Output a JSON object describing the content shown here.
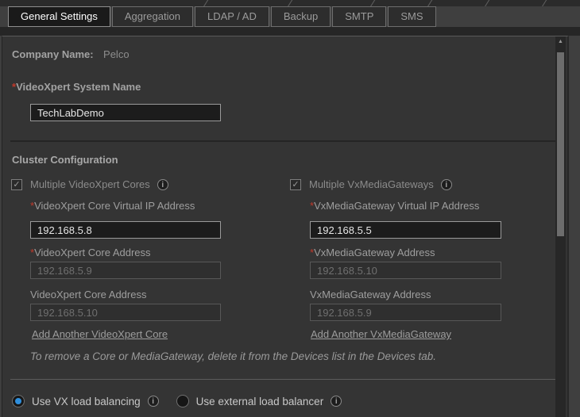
{
  "tabs": [
    {
      "label": "General Settings",
      "active": true
    },
    {
      "label": "Aggregation",
      "active": false
    },
    {
      "label": "LDAP / AD",
      "active": false
    },
    {
      "label": "Backup",
      "active": false
    },
    {
      "label": "SMTP",
      "active": false
    },
    {
      "label": "SMS",
      "active": false
    }
  ],
  "general": {
    "company_label": "Company Name:",
    "company_value": "Pelco",
    "system_name": {
      "required_mark": "*",
      "label": "VideoXpert System Name",
      "value": "TechLabDemo"
    }
  },
  "cluster": {
    "heading": "Cluster Configuration",
    "cores": {
      "checkbox_label": "Multiple VideoXpert Cores",
      "checked": true,
      "fields": [
        {
          "required_mark": "*",
          "label": "VideoXpert Core Virtual IP Address",
          "value": "192.168.5.8",
          "disabled": false
        },
        {
          "required_mark": "*",
          "label": "VideoXpert Core Address",
          "value": "192.168.5.9",
          "disabled": true
        },
        {
          "required_mark": "",
          "label": "VideoXpert Core Address",
          "value": "192.168.5.10",
          "disabled": true
        }
      ],
      "add_link": "Add Another VideoXpert Core"
    },
    "gateways": {
      "checkbox_label": "Multiple VxMediaGateways",
      "checked": true,
      "fields": [
        {
          "required_mark": "*",
          "label": "VxMediaGateway Virtual IP Address",
          "value": "192.168.5.5",
          "disabled": false
        },
        {
          "required_mark": "*",
          "label": "VxMediaGateway Address",
          "value": "192.168.5.10",
          "disabled": true
        },
        {
          "required_mark": "",
          "label": "VxMediaGateway Address",
          "value": "192.168.5.9",
          "disabled": true
        }
      ],
      "add_link": "Add Another VxMediaGateway"
    },
    "note": "To remove a Core or MediaGateway, delete it from the Devices list in the Devices tab."
  },
  "load_balancing": {
    "options": [
      {
        "label": "Use VX load balancing",
        "selected": true
      },
      {
        "label": "Use external load balancer",
        "selected": false
      }
    ]
  },
  "icons": {
    "check_glyph": "✓",
    "info_glyph": "i",
    "scroll_up_glyph": "▲"
  },
  "colors": {
    "required_red": "#c0392b",
    "radio_accent_blue": "#2f8fdd",
    "active_tab_text": "#ffffff",
    "panel_background": "#343434"
  }
}
